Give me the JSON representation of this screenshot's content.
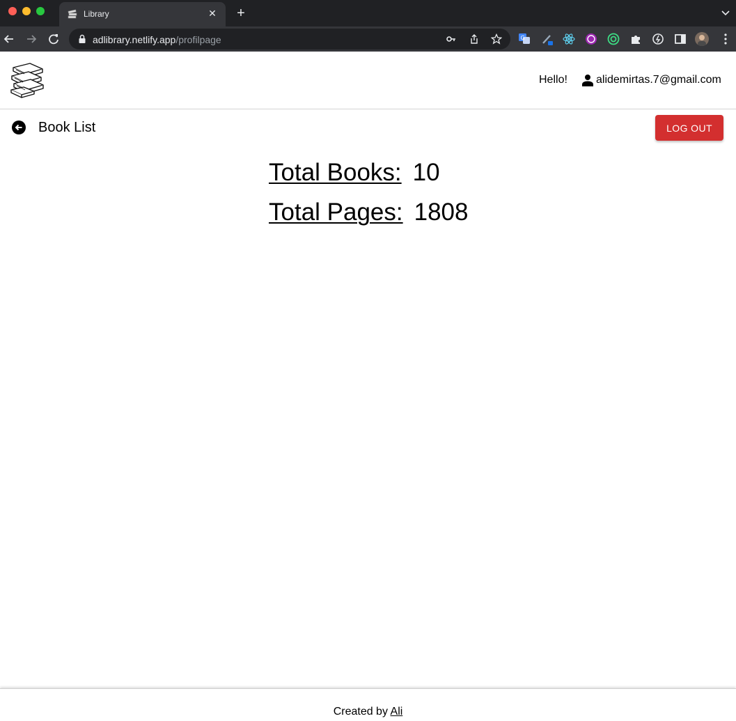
{
  "browser": {
    "tab_title": "Library",
    "tab_close_glyph": "✕",
    "new_tab_glyph": "+",
    "url_host": "adlibrary.netlify.app",
    "url_path": "/profilpage",
    "extensions": [
      "translate-icon",
      "pen-extension-icon",
      "react-devtools-icon",
      "redux-devtools-icon",
      "circle-extension-icon",
      "puzzle-icon",
      "refresh-extension-icon",
      "sidepanel-icon"
    ]
  },
  "header": {
    "logo_icon": "books-stack-icon",
    "greeting": "Hello!",
    "user_icon": "person-icon",
    "email": "alidemirtas.7@gmail.com"
  },
  "subbar": {
    "back_icon": "arrow-left-circle-icon",
    "title": "Book List",
    "logout_label": "LOG OUT",
    "logout_color": "#d32f2f"
  },
  "stats": {
    "books_label": "Total Books:",
    "books_value": "10",
    "pages_label": "Total Pages:",
    "pages_value": "1808"
  },
  "footer": {
    "prefix": "Created by",
    "author": "Ali"
  }
}
